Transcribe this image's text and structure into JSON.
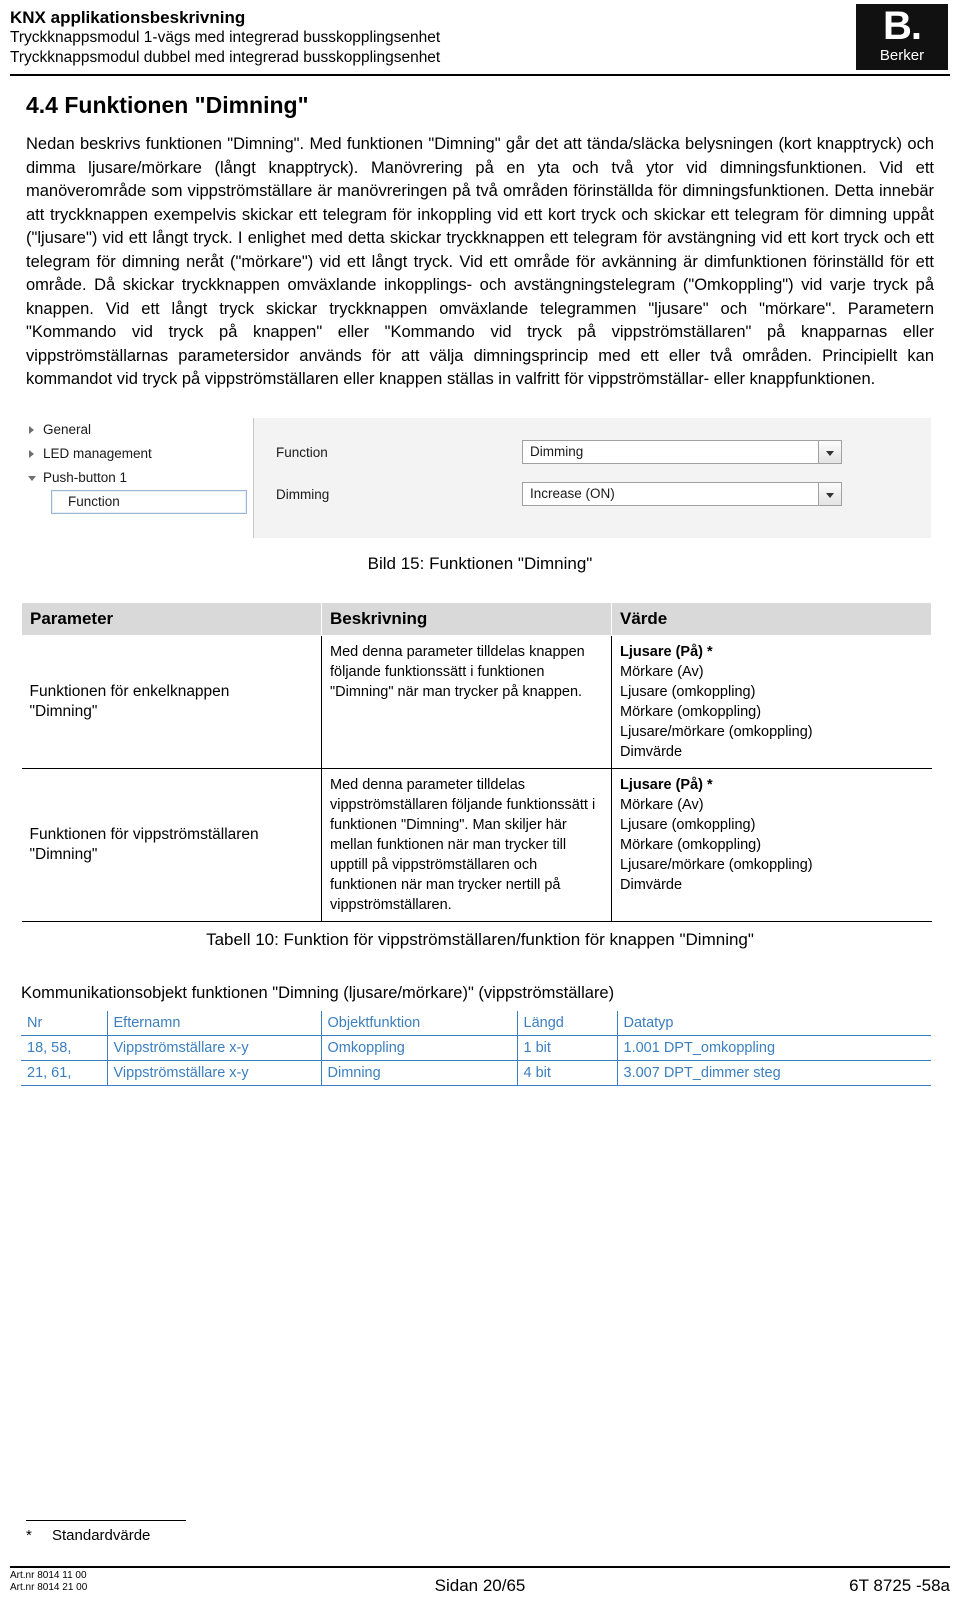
{
  "header": {
    "title": "KNX applikationsbeskrivning",
    "line2": "Tryckknappsmodul 1-vägs med integrerad busskopplingsenhet",
    "line3": "Tryckknappsmodul dubbel med integrerad busskopplingsenhet",
    "logo_mark": "B.",
    "logo_name": "Berker"
  },
  "section": {
    "title": "4.4  Funktionen \"Dimning\"",
    "paragraph": "Nedan beskrivs funktionen \"Dimning\". Med funktionen \"Dimning\" går det att tända/släcka belysningen (kort knapptryck) och dimma ljusare/mörkare (långt knapptryck). Manövrering på en yta och två ytor vid dimningsfunktionen. Vid ett manöverområde som vippströmställare är manövreringen på två områden förinställda för dimningsfunktionen. Detta innebär att tryckknappen exempelvis skickar ett telegram för inkoppling vid ett kort tryck och skickar ett telegram för dimning uppåt (\"ljusare\") vid ett långt tryck. I enlighet med detta skickar tryckknappen ett telegram för avstängning vid ett kort tryck och ett telegram för dimning neråt (\"mörkare\") vid ett långt tryck. Vid ett område för avkänning är dimfunktionen förinställd för ett område. Då skickar tryckknappen omväxlande inkopplings- och avstängningstelegram (\"Omkoppling\") vid varje tryck på knappen. Vid ett långt tryck skickar tryckknappen omväxlande telegrammen \"ljusare\" och \"mörkare\". Parametern \"Kommando vid tryck på knappen\" eller \"Kommando vid tryck på vippströmställaren\" på knapparnas eller vippströmställarnas parametersidor används för att välja dimningsprincip med ett eller två områden. Principiellt kan kommandot vid tryck på vippströmställaren eller knappen ställas in valfritt för vippströmställar- eller knappfunktionen."
  },
  "screenshot": {
    "tree": [
      {
        "label": "General",
        "level": 0,
        "expandable": true,
        "selected": false
      },
      {
        "label": "LED management",
        "level": 0,
        "expandable": true,
        "selected": false
      },
      {
        "label": "Push-button 1",
        "level": 0,
        "expandable": true,
        "expanded": true,
        "selected": false
      },
      {
        "label": "Function",
        "level": 1,
        "expandable": false,
        "selected": true
      }
    ],
    "rows": [
      {
        "label": "Function",
        "value": "Dimming"
      },
      {
        "label": "Dimming",
        "value": "Increase (ON)"
      }
    ],
    "caption": "Bild 15:  Funktionen \"Dimning\""
  },
  "param_table": {
    "headers": [
      "Parameter",
      "Beskrivning",
      "Värde"
    ],
    "rows": [
      {
        "parameter": "Funktionen för enkelknappen\n\"Dimning\"",
        "beskrivning": "Med denna parameter tilldelas knappen följande funktionssätt i funktionen \"Dimning\" när man trycker på knappen.",
        "varde_bold": "Ljusare (På) *",
        "varde_rest": "Mörkare (Av)\nLjusare (omkoppling)\nMörkare (omkoppling)\nLjusare/mörkare (omkoppling)\nDimvärde"
      },
      {
        "parameter": "Funktionen för vippströmställaren\n\"Dimning\"",
        "beskrivning": "Med denna parameter tilldelas vippströmställaren följande funktionssätt i funktionen \"Dimning\". Man skiljer här mellan funktionen när man trycker till upptill på vippströmställaren och funktionen när man trycker nertill på vippströmställaren.",
        "varde_bold": "Ljusare (På) *",
        "varde_rest": "Mörkare (Av)\nLjusare (omkoppling)\nMörkare (omkoppling)\nLjusare/mörkare (omkoppling)\nDimvärde"
      }
    ],
    "caption": "Tabell 10:  Funktion för vippströmställaren/funktion för knappen \"Dimning\""
  },
  "comm_objects": {
    "title": "Kommunikationsobjekt funktionen \"Dimning (ljusare/mörkare)\" (vippströmställare)",
    "headers": [
      "Nr",
      "Efternamn",
      "Objektfunktion",
      "Längd",
      "Datatyp"
    ],
    "rows": [
      [
        "18, 58,",
        "Vippströmställare x-y",
        "Omkoppling",
        "1 bit",
        "1.001 DPT_omkoppling"
      ],
      [
        "21, 61,",
        "Vippströmställare x-y",
        "Dimning",
        "4 bit",
        "3.007 DPT_dimmer steg"
      ]
    ],
    "accent_color": "#3b7fbf"
  },
  "footnote": {
    "star": "*",
    "text": "Standardvärde"
  },
  "footer": {
    "left_line1": "Art.nr 8014 11 00",
    "left_line2": "Art.nr 8014 21 00",
    "center": "Sidan 20/65",
    "right": "6T 8725 -58a"
  }
}
